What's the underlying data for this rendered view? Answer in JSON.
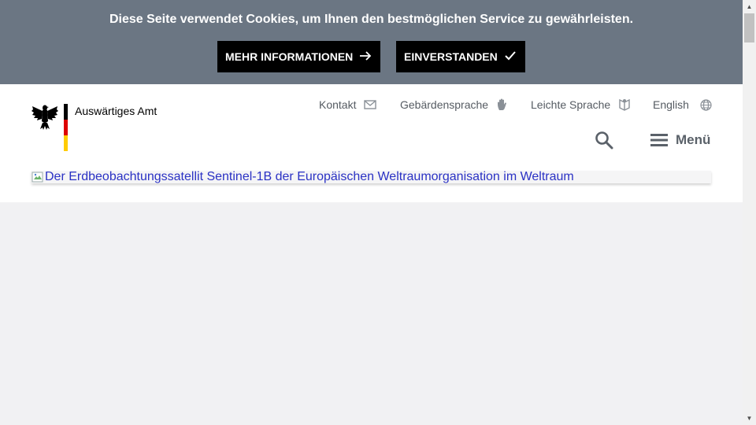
{
  "cookie_banner": {
    "message": "Diese Seite verwendet Cookies, um Ihnen den bestmöglichen Service zu gewährleisten.",
    "more_info_label": "MEHR INFORMATIONEN",
    "accept_label": "EINVERSTANDEN"
  },
  "header": {
    "logo_text": "Auswärtiges Amt",
    "meta_nav": [
      {
        "label": "Kontakt",
        "icon": "mail-icon"
      },
      {
        "label": "Gebärdensprache",
        "icon": "hand-icon"
      },
      {
        "label": "Leichte Sprache",
        "icon": "book-icon"
      },
      {
        "label": "English",
        "icon": "globe-icon"
      }
    ],
    "menu_label": "Menü"
  },
  "hero": {
    "image_alt": "Der Erdbeobachtungssatellit Sentinel-1B der Europäischen Weltraumorganisation im Weltraum"
  },
  "colors": {
    "banner_bg": "#6b7683",
    "flag_black": "#000000",
    "flag_red": "#dd0000",
    "flag_gold": "#ffcc00",
    "link_blue": "#2a31c4"
  }
}
